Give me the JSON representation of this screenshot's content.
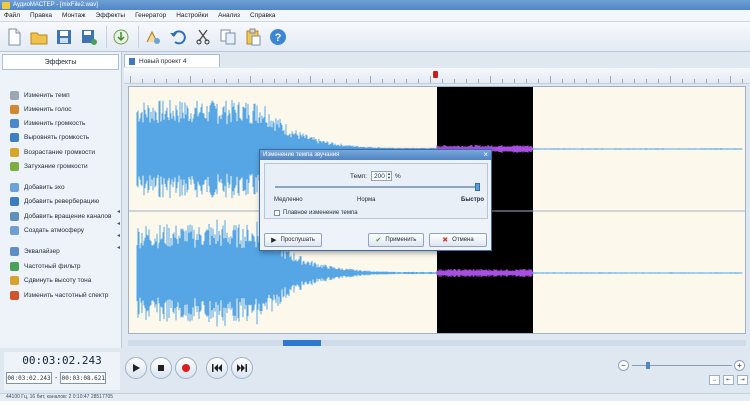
{
  "window": {
    "title": "АудиоМАСТЕР - [mixFile2.wav]"
  },
  "menu": [
    "Файл",
    "Правка",
    "Монтаж",
    "Эффекты",
    "Генератор",
    "Настройки",
    "Анализ",
    "Справка"
  ],
  "toolbar": {
    "icons": [
      "new-file-icon",
      "open-folder-icon",
      "save-icon",
      "save-as-icon",
      "record-from-mic-icon",
      "undo-effect-icon",
      "undo-icon",
      "cut-icon",
      "copy-icon",
      "paste-icon",
      "help-icon"
    ]
  },
  "effects": {
    "header": "Эффекты",
    "items": [
      {
        "label": "Изменить темп",
        "icon": "tempo-icon",
        "color": "#9aa7b6"
      },
      {
        "label": "Изменить голос",
        "icon": "voice-icon",
        "color": "#d2882f"
      },
      {
        "label": "Изменить громкость",
        "icon": "volume-icon",
        "color": "#4a87cc"
      },
      {
        "label": "Выровнять громкость",
        "icon": "normalize-icon",
        "color": "#3e7fc4"
      },
      {
        "label": "Возрастание громкости",
        "icon": "fade-in-icon",
        "color": "#d7a624"
      },
      {
        "label": "Затухание громкости",
        "icon": "fade-out-icon",
        "color": "#7cae44"
      },
      {
        "label": "Добавить эхо",
        "icon": "echo-icon",
        "color": "#69a3d9"
      },
      {
        "label": "Добавить реверберацию",
        "icon": "reverb-icon",
        "color": "#3b7cc2"
      },
      {
        "label": "Добавить вращение каналов",
        "icon": "channel-rotation-icon",
        "color": "#5f8fbd"
      },
      {
        "label": "Создать атмосферу",
        "icon": "atmosphere-icon",
        "color": "#6e9fd2"
      },
      {
        "label": "Эквалайзер",
        "icon": "equalizer-icon",
        "color": "#5b8ec5"
      },
      {
        "label": "Частотный фильтр",
        "icon": "frequency-filter-icon",
        "color": "#4aa15a"
      },
      {
        "label": "Сдвинуть высоту тона",
        "icon": "pitch-shift-icon",
        "color": "#d8a22e"
      },
      {
        "label": "Изменить частотный спектр",
        "icon": "spectrum-icon",
        "color": "#d0552b"
      }
    ]
  },
  "project": {
    "tab_label": "Новый проект 4"
  },
  "dialog": {
    "title": "Изменение темпа звучания",
    "tempo_label": "Темп:",
    "tempo_value": "200",
    "tempo_unit": "%",
    "tempo_level": 1.0,
    "slow_label": "Медленно",
    "norm_label": "Норма",
    "fast_label": "Быстро",
    "smooth_label": "Плавное изменение темпа",
    "smooth_checked": false,
    "preview_button": "Прослушать",
    "apply_button": "Применить",
    "cancel_button": "Отмена"
  },
  "transport": {
    "current_time": "00:03:02.243",
    "selection_start": "00:03:02.243",
    "selection_end": "00:03:08.621",
    "range_separator": "-"
  },
  "status": {
    "text": "44100 Гц, 16 бит, каналов: 2   0:10:47 28517705"
  },
  "colors": {
    "waveform": "#56a6e6",
    "selection_wave": "#a64fe0",
    "selection_bg": "#000000",
    "track_bg": "#fdf8ec",
    "accent": "#2d78d0"
  }
}
